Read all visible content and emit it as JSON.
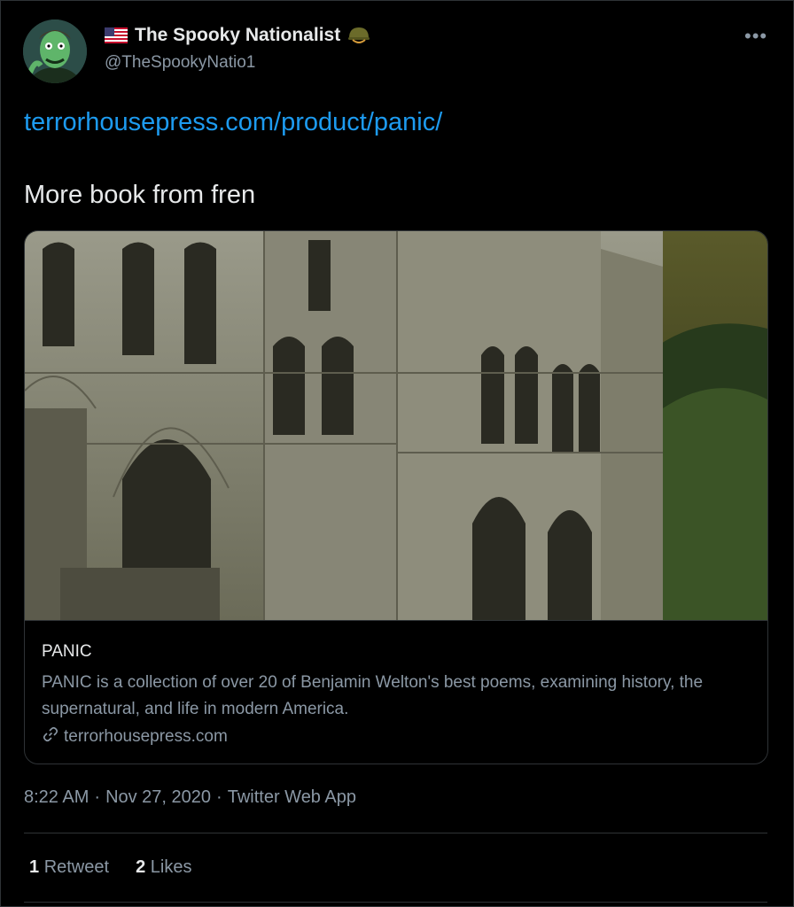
{
  "author": {
    "display_name": "The Spooky Nationalist",
    "handle": "@TheSpookyNatio1",
    "flag_icon": "us-flag-icon",
    "badge_icon": "military-helmet-icon"
  },
  "menu": {
    "more_label": "•••"
  },
  "tweet": {
    "link_text": "terrorhousepress.com/product/panic/",
    "text": "More book from fren"
  },
  "card": {
    "title": "PANIC",
    "description": "PANIC is a collection of over 20 of Benjamin Welton's best poems, examining history, the supernatural, and life in modern America.",
    "domain": "terrorhousepress.com",
    "domain_icon": "link-icon"
  },
  "meta": {
    "time": "8:22 AM",
    "separator1": "·",
    "date": "Nov 27, 2020",
    "separator2": "·",
    "source": "Twitter Web App"
  },
  "stats": {
    "retweet_count": "1",
    "retweet_label": "Retweet",
    "like_count": "2",
    "like_label": "Likes"
  },
  "colors": {
    "background": "#000000",
    "link": "#1d9bf0",
    "secondary_text": "#8b98a5",
    "border": "#2f3336"
  }
}
